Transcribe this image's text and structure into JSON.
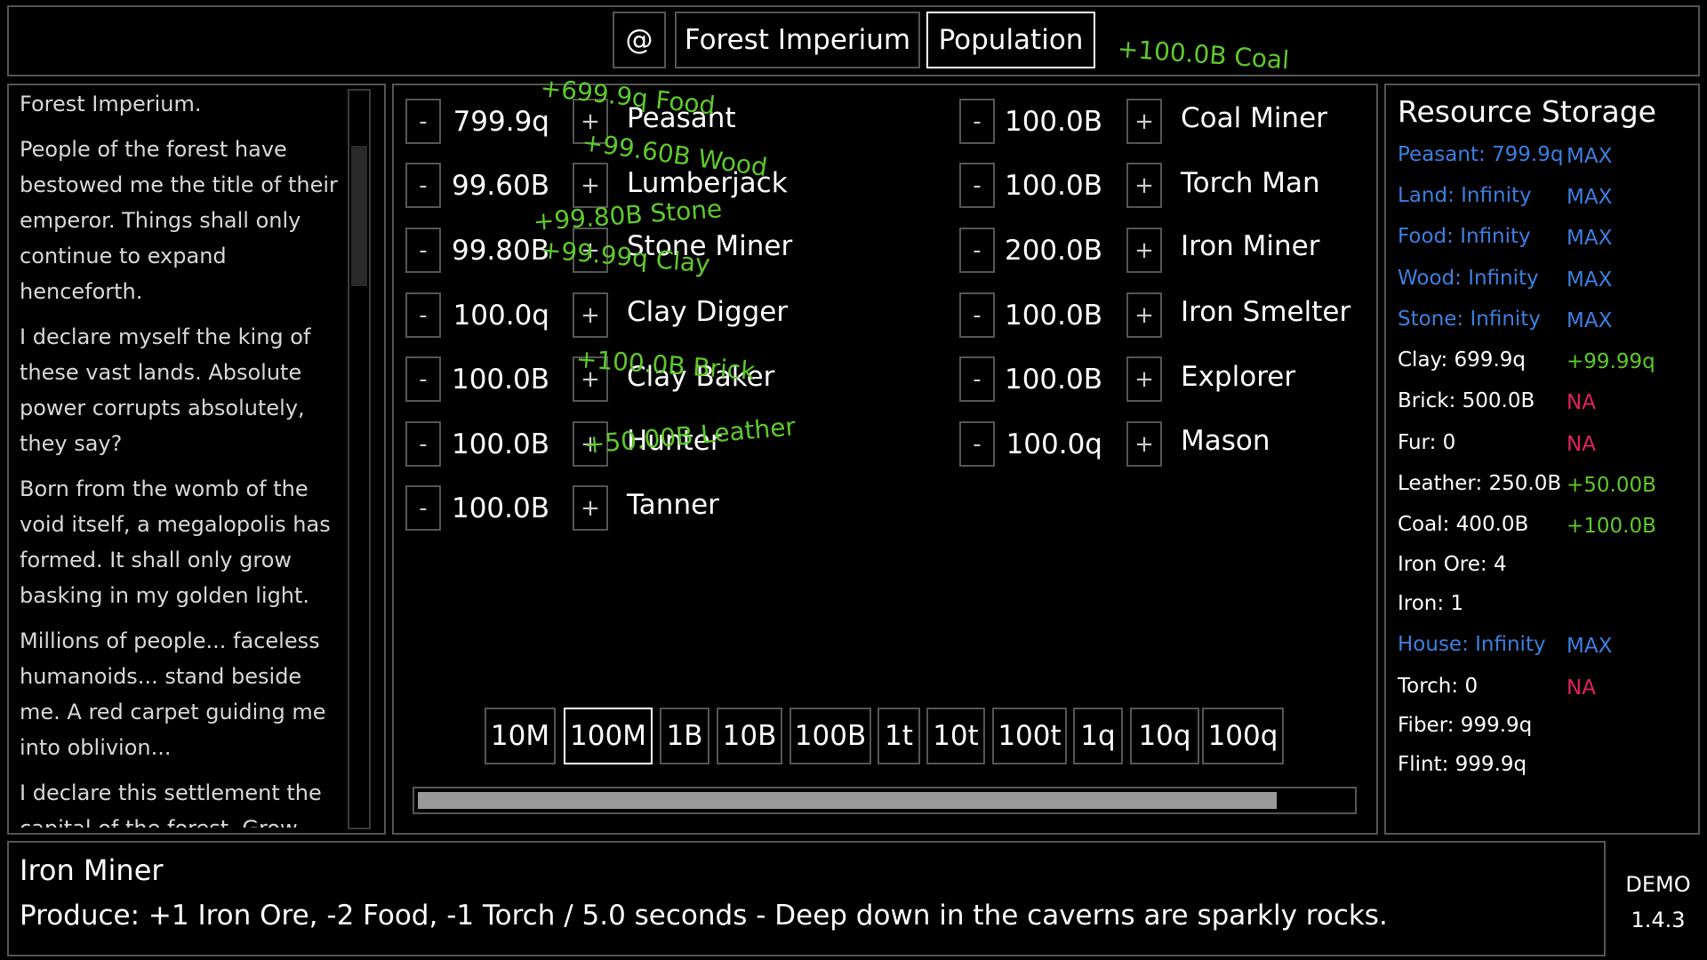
{
  "header": {
    "home_icon": "@",
    "tabs": [
      {
        "label": "Forest Imperium",
        "selected": false
      },
      {
        "label": "Population",
        "selected": true
      }
    ]
  },
  "story": {
    "paragraphs": [
      "Forest Imperium.",
      "People of the forest have bestowed me the title of their emperor. Things shall only continue to expand henceforth.",
      "I declare myself the king of these vast lands. Absolute power corrupts absolutely, they say?",
      "Born from the womb of the void itself, a megalopolis has formed. It shall only grow basking in my golden light.",
      "Millions of people... faceless humanoids... stand beside me. A red carpet guiding me into oblivion...",
      "I declare this settlement the capital of the forest. Grow beyond this pestilent place and carve our name into this world"
    ]
  },
  "population": {
    "minus_label": "-",
    "plus_label": "+",
    "left_jobs": [
      {
        "count": "799.9q",
        "name": "Peasant"
      },
      {
        "count": "99.60B",
        "name": "Lumberjack"
      },
      {
        "count": "99.80B",
        "name": "Stone Miner"
      },
      {
        "count": "100.0q",
        "name": "Clay Digger"
      },
      {
        "count": "100.0B",
        "name": "Clay Baker"
      },
      {
        "count": "100.0B",
        "name": "Hunter"
      },
      {
        "count": "100.0B",
        "name": "Tanner"
      }
    ],
    "right_jobs": [
      {
        "count": "100.0B",
        "name": "Coal Miner"
      },
      {
        "count": "100.0B",
        "name": "Torch Man"
      },
      {
        "count": "200.0B",
        "name": "Iron Miner"
      },
      {
        "count": "100.0B",
        "name": "Iron Smelter"
      },
      {
        "count": "100.0B",
        "name": "Explorer"
      },
      {
        "count": "100.0q",
        "name": "Mason"
      }
    ],
    "floating_gains": [
      "+100.0B Coal",
      "+699.9q Food",
      "+99.60B Wood",
      "+99.80B Stone",
      "+99.99q Clay",
      "+100.0B Brick",
      "+50.00B Leather"
    ],
    "multipliers": [
      {
        "label": "10M",
        "selected": false
      },
      {
        "label": "100M",
        "selected": true
      },
      {
        "label": "1B",
        "selected": false
      },
      {
        "label": "10B",
        "selected": false
      },
      {
        "label": "100B",
        "selected": false
      },
      {
        "label": "1t",
        "selected": false
      },
      {
        "label": "10t",
        "selected": false
      },
      {
        "label": "100t",
        "selected": false
      },
      {
        "label": "1q",
        "selected": false
      },
      {
        "label": "10q",
        "selected": false
      },
      {
        "label": "100q",
        "selected": false
      }
    ],
    "progress_fraction": 0.92
  },
  "resources": {
    "title": "Resource Storage",
    "items": [
      {
        "label": "Peasant: 799.9q",
        "value": "MAX",
        "label_color": "#3d7fe0",
        "value_color": "#3d7fe0"
      },
      {
        "label": "Land: Infinity",
        "value": "MAX",
        "label_color": "#3d7fe0",
        "value_color": "#3d7fe0"
      },
      {
        "label": "Food: Infinity",
        "value": "MAX",
        "label_color": "#3d7fe0",
        "value_color": "#3d7fe0"
      },
      {
        "label": "Wood: Infinity",
        "value": "MAX",
        "label_color": "#3d7fe0",
        "value_color": "#3d7fe0"
      },
      {
        "label": "Stone: Infinity",
        "value": "MAX",
        "label_color": "#3d7fe0",
        "value_color": "#3d7fe0"
      },
      {
        "label": "Clay: 699.9q",
        "value": "+99.99q",
        "label_color": "#ffffff",
        "value_color": "#5ec82c"
      },
      {
        "label": "Brick: 500.0B",
        "value": "NA",
        "label_color": "#ffffff",
        "value_color": "#e0245c"
      },
      {
        "label": "Fur: 0",
        "value": "NA",
        "label_color": "#ffffff",
        "value_color": "#e0245c"
      },
      {
        "label": "Leather: 250.0B",
        "value": "+50.00B",
        "label_color": "#ffffff",
        "value_color": "#5ec82c"
      },
      {
        "label": "Coal: 400.0B",
        "value": "+100.0B",
        "label_color": "#ffffff",
        "value_color": "#5ec82c"
      },
      {
        "label": "Iron Ore: 4",
        "value": "",
        "label_color": "#ffffff",
        "value_color": "#ffffff"
      },
      {
        "label": "Iron: 1",
        "value": "",
        "label_color": "#ffffff",
        "value_color": "#ffffff"
      },
      {
        "label": "House: Infinity",
        "value": "MAX",
        "label_color": "#3d7fe0",
        "value_color": "#3d7fe0"
      },
      {
        "label": "Torch: 0",
        "value": "NA",
        "label_color": "#ffffff",
        "value_color": "#e0245c"
      },
      {
        "label": "Fiber: 999.9q",
        "value": "",
        "label_color": "#ffffff",
        "value_color": "#ffffff"
      },
      {
        "label": "Flint: 999.9q",
        "value": "",
        "label_color": "#ffffff",
        "value_color": "#ffffff"
      }
    ]
  },
  "info": {
    "title": "Iron Miner",
    "description": "Produce: +1 Iron Ore, -2 Food, -1 Torch / 5.0 seconds - Deep down in the caverns are sparkly rocks."
  },
  "version": {
    "demo": "DEMO",
    "number": "1.4.3"
  }
}
